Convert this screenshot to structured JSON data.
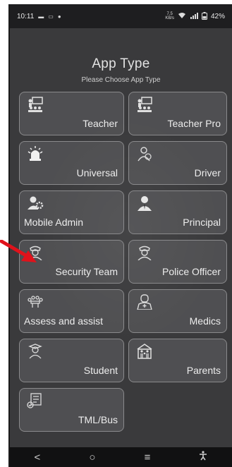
{
  "status_bar": {
    "time": "10:11",
    "net_speed_value": "7.5",
    "net_speed_unit": "KB/s",
    "battery": "42%"
  },
  "header": {
    "title": "App Type",
    "subtitle": "Please Choose App Type"
  },
  "tiles": [
    {
      "label": "Teacher",
      "icon": "teacher-icon"
    },
    {
      "label": "Teacher Pro",
      "icon": "teacher-icon"
    },
    {
      "label": "Universal",
      "icon": "alarm-light-icon"
    },
    {
      "label": "Driver",
      "icon": "driver-icon"
    },
    {
      "label": "Mobile Admin",
      "icon": "admin-gear-icon"
    },
    {
      "label": "Principal",
      "icon": "principal-icon"
    },
    {
      "label": "Security Team",
      "icon": "security-guard-icon"
    },
    {
      "label": "Police Officer",
      "icon": "police-officer-icon"
    },
    {
      "label": "Assess and assist",
      "icon": "meeting-icon"
    },
    {
      "label": "Medics",
      "icon": "doctor-icon"
    },
    {
      "label": "Student",
      "icon": "student-icon"
    },
    {
      "label": "Parents",
      "icon": "family-icon"
    },
    {
      "label": "TML/Bus",
      "icon": "checklist-icon"
    }
  ],
  "nav": {
    "back": "<",
    "home": "○",
    "recents": "≡",
    "accessibility": "accessibility-icon"
  },
  "colors": {
    "background": "#3a3a3c",
    "tile_border": "#8a8a8c",
    "annotation_arrow": "#e0121b"
  }
}
